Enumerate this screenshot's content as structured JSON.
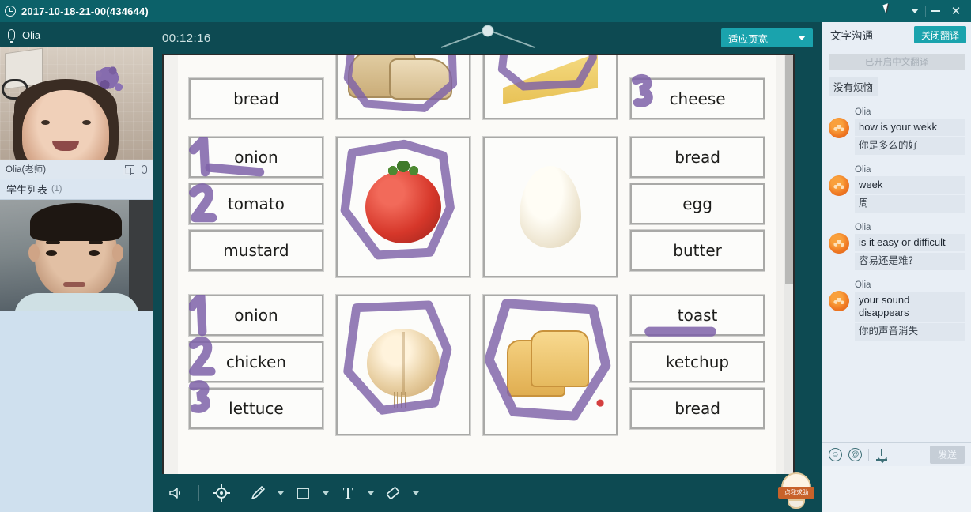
{
  "window": {
    "title": "2017-10-18-21-00(434644)",
    "clock_icon": "clock-icon",
    "controls": {
      "collapse": "caret-down-icon",
      "minimize": "minimize-icon",
      "close": "close-icon"
    }
  },
  "left": {
    "mic_label": "Olia",
    "teacher_bar": {
      "name": "Olia(老师)",
      "window_icon": "window-icon",
      "mic_icon": "microphone-icon"
    },
    "student_list": {
      "label": "学生列表",
      "count": "(1)"
    }
  },
  "center": {
    "timer": "00:12:16",
    "fit_width_label": "适应页宽",
    "collapse_handle": "collapse-handle"
  },
  "board": {
    "rows": [
      {
        "words": [
          "bread"
        ],
        "marks": [
          "",
          ""
        ],
        "picture": "bread-loaf",
        "picture2": "cheese-wedge",
        "words_right": [
          "cheese"
        ],
        "marks_right": [
          "3"
        ]
      },
      {
        "words": [
          "onion",
          "tomato",
          "mustard"
        ],
        "marks": [
          "1",
          "2",
          ""
        ],
        "picture": "tomato",
        "picture2": "egg",
        "words_right": [
          "bread",
          "egg",
          "butter"
        ],
        "marks_right": [
          "",
          "",
          ""
        ]
      },
      {
        "words": [
          "onion",
          "chicken",
          "lettuce"
        ],
        "marks": [
          "1",
          "2",
          "3"
        ],
        "picture": "onion-bulb",
        "picture2": "toast-stack",
        "words_right": [
          "toast",
          "ketchup",
          "bread"
        ],
        "marks_right": [
          "",
          "",
          ""
        ]
      }
    ],
    "ink_color": "#7e62a8"
  },
  "toolbar": {
    "items": [
      {
        "name": "volume-icon",
        "label": ""
      },
      {
        "name": "laser-pointer-icon",
        "label": ""
      },
      {
        "name": "pencil-icon",
        "label": ""
      },
      {
        "name": "rectangle-icon",
        "label": ""
      },
      {
        "name": "text-icon",
        "label": "T"
      },
      {
        "name": "eraser-icon",
        "label": ""
      }
    ],
    "help_badge": "点我求助"
  },
  "chat": {
    "header_title": "文字沟通",
    "close_translate_label": "关闭翻译",
    "system_banner": "已开启中文翻译",
    "system_note": "没有烦恼",
    "messages": [
      {
        "name": "Olia",
        "en": "how is your wekk",
        "zh": "你是多么的好"
      },
      {
        "name": "Olia",
        "en": "week",
        "zh": "周"
      },
      {
        "name": "Olia",
        "en": "is it easy or difficult",
        "zh": "容易还是难？"
      },
      {
        "name": "Olia",
        "en": "your sound disappears",
        "zh": "你的声音消失"
      }
    ],
    "tools": {
      "emoji": "☺",
      "mention": "@",
      "download": "download-icon"
    },
    "send_label": "发送"
  },
  "colors": {
    "teal_title": "#0c6169",
    "teal_dark": "#0d4a52",
    "accent": "#1aa3ad",
    "ink_purple": "#7e62a8",
    "chat_bg": "#e8eef5"
  }
}
